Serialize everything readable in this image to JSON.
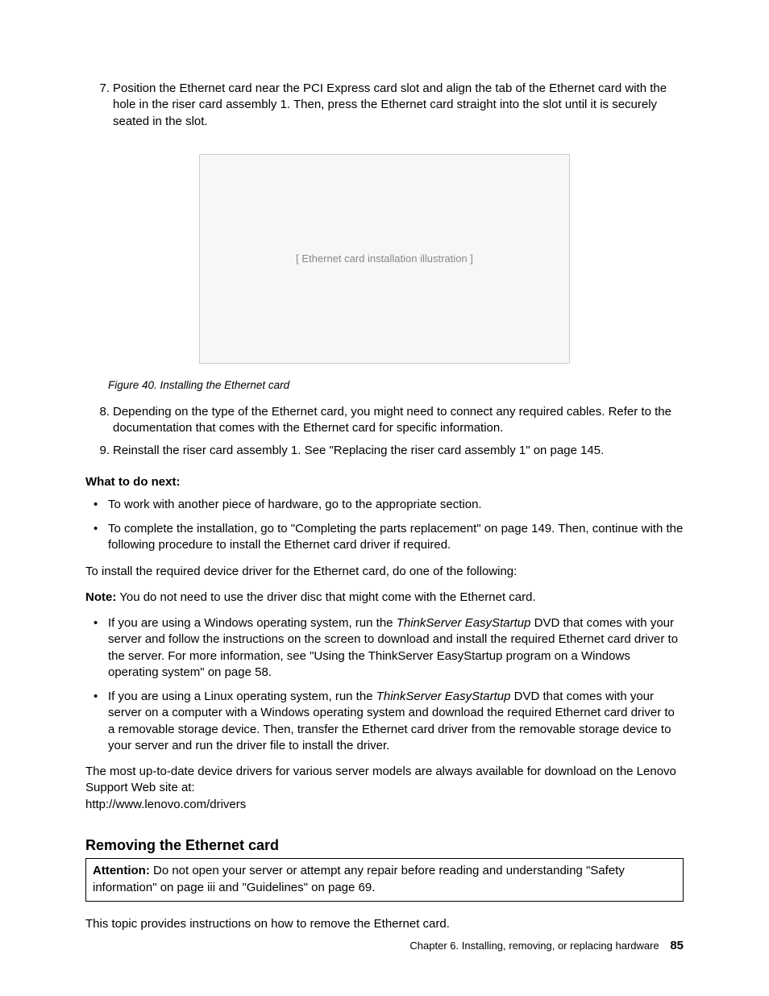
{
  "steps": {
    "s7": {
      "num": "7.",
      "text": "Position the Ethernet card near the PCI Express card slot and align the tab of the Ethernet card with the hole in the riser card assembly 1. Then, press the Ethernet card straight into the slot until it is securely seated in the slot."
    },
    "s8": {
      "num": "8.",
      "text": "Depending on the type of the Ethernet card, you might need to connect any required cables. Refer to the documentation that comes with the Ethernet card for specific information."
    },
    "s9": {
      "num": "9.",
      "text": "Reinstall the riser card assembly 1. See \"Replacing the riser card assembly 1\" on page 145."
    }
  },
  "figure": {
    "placeholder": "[ Ethernet card installation illustration ]",
    "caption": "Figure 40.  Installing the Ethernet card"
  },
  "next": {
    "heading": "What to do next:",
    "b1": "To work with another piece of hardware, go to the appropriate section.",
    "b2": "To complete the installation, go to \"Completing the parts replacement\" on page 149. Then, continue with the following procedure to install the Ethernet card driver if required."
  },
  "driver": {
    "intro": "To install the required device driver for the Ethernet card, do one of the following:",
    "note_label": "Note:",
    "note_text": " You do not need to use the driver disc that might come with the Ethernet card.",
    "win_a": "If you are using a Windows operating system, run the ",
    "win_em": "ThinkServer EasyStartup",
    "win_b": " DVD that comes with your server and follow the instructions on the screen to download and install the required Ethernet card driver to the server. For more information, see \"Using the ThinkServer EasyStartup program on a Windows operating system\" on page 58.",
    "lin_a": "If you are using a Linux operating system, run the ",
    "lin_em": "ThinkServer EasyStartup",
    "lin_b": " DVD that comes with your server on a computer with a Windows operating system and download the required Ethernet card driver to a removable storage device. Then, transfer the Ethernet card driver from the removable storage device to your server and run the driver file to install the driver.",
    "outro1": "The most up-to-date device drivers for various server models are always available for download on the Lenovo Support Web site at:",
    "outro2": "http://www.lenovo.com/drivers"
  },
  "removing": {
    "heading": "Removing the Ethernet card",
    "attn_label": "Attention:",
    "attn_text": " Do not open your server or attempt any repair before reading and understanding \"Safety information\" on page iii and \"Guidelines\" on page 69.",
    "intro": "This topic provides instructions on how to remove the Ethernet card."
  },
  "footer": {
    "chapter": "Chapter 6.  Installing, removing, or replacing hardware",
    "page": "85"
  }
}
